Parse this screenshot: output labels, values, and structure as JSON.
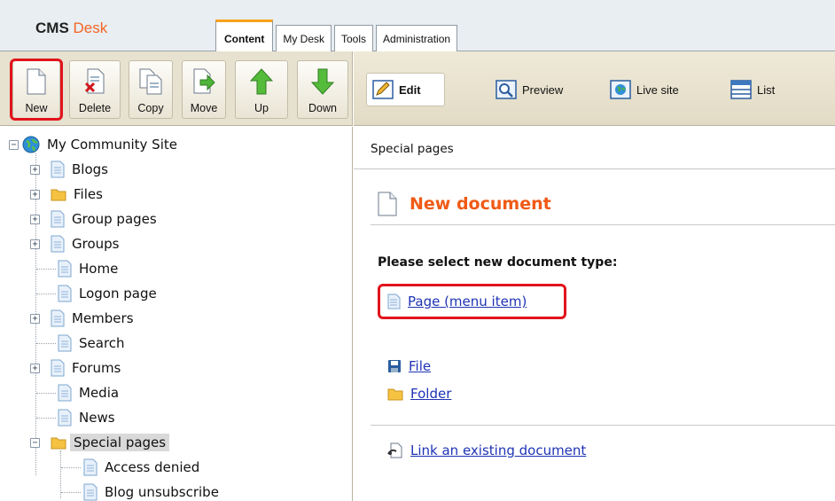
{
  "header": {
    "logo_prefix": "CMS",
    "logo_suffix": "Desk",
    "tabs": [
      {
        "label": "Content",
        "active": true
      },
      {
        "label": "My Desk",
        "active": false
      },
      {
        "label": "Tools",
        "active": false
      },
      {
        "label": "Administration",
        "active": false
      }
    ]
  },
  "toolbar": {
    "actions": [
      {
        "label": "New",
        "icon": "new-document-icon"
      },
      {
        "label": "Delete",
        "icon": "delete-document-icon"
      },
      {
        "label": "Copy",
        "icon": "copy-document-icon"
      },
      {
        "label": "Move",
        "icon": "move-document-icon"
      },
      {
        "label": "Up",
        "icon": "arrow-up-icon"
      },
      {
        "label": "Down",
        "icon": "arrow-down-icon"
      }
    ],
    "views": [
      {
        "label": "Edit",
        "icon": "edit-pencil-icon",
        "active": true
      },
      {
        "label": "Preview",
        "icon": "preview-magnifier-icon",
        "active": false
      },
      {
        "label": "Live site",
        "icon": "live-site-globe-icon",
        "active": false
      },
      {
        "label": "List",
        "icon": "list-view-icon",
        "active": false
      }
    ],
    "highlighted_action": "New"
  },
  "tree": {
    "root": "My Community Site",
    "items": [
      {
        "label": "Blogs",
        "expandable": true,
        "icon": "document-icon"
      },
      {
        "label": "Files",
        "expandable": true,
        "icon": "folder-icon"
      },
      {
        "label": "Group pages",
        "expandable": true,
        "icon": "document-icon"
      },
      {
        "label": "Groups",
        "expandable": true,
        "icon": "document-icon"
      },
      {
        "label": "Home",
        "expandable": false,
        "icon": "document-icon"
      },
      {
        "label": "Logon page",
        "expandable": false,
        "icon": "document-icon"
      },
      {
        "label": "Members",
        "expandable": true,
        "icon": "document-icon"
      },
      {
        "label": "Search",
        "expandable": false,
        "icon": "document-icon"
      },
      {
        "label": "Forums",
        "expandable": true,
        "icon": "document-icon"
      },
      {
        "label": "Media",
        "expandable": false,
        "icon": "document-icon"
      },
      {
        "label": "News",
        "expandable": false,
        "icon": "document-icon"
      },
      {
        "label": "Special pages",
        "expandable": true,
        "expanded": true,
        "selected": true,
        "icon": "folder-icon"
      }
    ],
    "children": [
      {
        "label": "Access denied",
        "icon": "document-icon"
      },
      {
        "label": "Blog unsubscribe",
        "icon": "document-icon"
      }
    ]
  },
  "content": {
    "breadcrumb": "Special pages",
    "title": "New document",
    "prompt": "Please select new document type:",
    "doc_types": [
      {
        "label": "Page (menu item)",
        "icon": "page-icon",
        "highlighted": true
      },
      {
        "label": "File",
        "icon": "save-disk-icon"
      },
      {
        "label": "Folder",
        "icon": "folder-icon"
      }
    ],
    "link_existing": "Link an existing document"
  },
  "colors": {
    "accent_orange": "#f05a16",
    "highlight_red": "#e1141c",
    "link_blue": "#1e33b4",
    "tab_active_top": "#f7a21b"
  }
}
